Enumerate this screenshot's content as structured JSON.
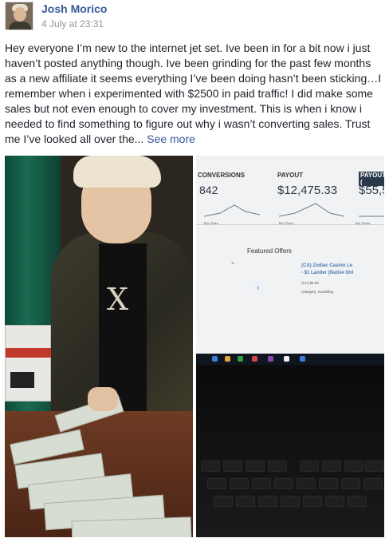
{
  "post": {
    "author": "Josh Morico",
    "timestamp": "4 July at 23:31",
    "text_lines": [
      "Hey everyone I’m new to the internet jet set. Ive been in for a bit now i just",
      "haven’t posted anything though. Ive been grinding for the past few months",
      "as a new affiliate it seems everything I’ve been doing hasn’t been sticking…I",
      "remember when i experimented with $2500 in paid traffic! I did make some",
      "sales but not even enough to cover my investment. This is when i know i",
      "needed to find something to figure out why i wasn’t converting sales. Trust",
      "me I’ve looked all over the..."
    ],
    "see_more_label": "See more"
  },
  "photo_left": {
    "shirt_letter": "X"
  },
  "photo_right": {
    "columns": [
      {
        "header": "Conversions",
        "value": "842",
        "nodata": "No Data"
      },
      {
        "header": "Payout",
        "value": "$12,475.33",
        "nodata": "No Data"
      },
      {
        "header": "Payout (",
        "value": "$55,5",
        "nodata": "No Data"
      }
    ],
    "featured_title": "Featured Offers",
    "offer": {
      "name_line1": "(CA) Zodiac Casino Le",
      "name_line2": "- $1 Lander (Native Onl",
      "meta_line1": "(CA) $5.00",
      "meta_line2": "Category: Gambling"
    },
    "close_glyph": "×",
    "nav_glyph": "‹",
    "taskbar_colors": [
      "#3d7bd6",
      "#e8a33c",
      "#2f9e44",
      "#d64545",
      "#8e44ad",
      "#f1f1f1",
      "#3d7bd6"
    ]
  }
}
